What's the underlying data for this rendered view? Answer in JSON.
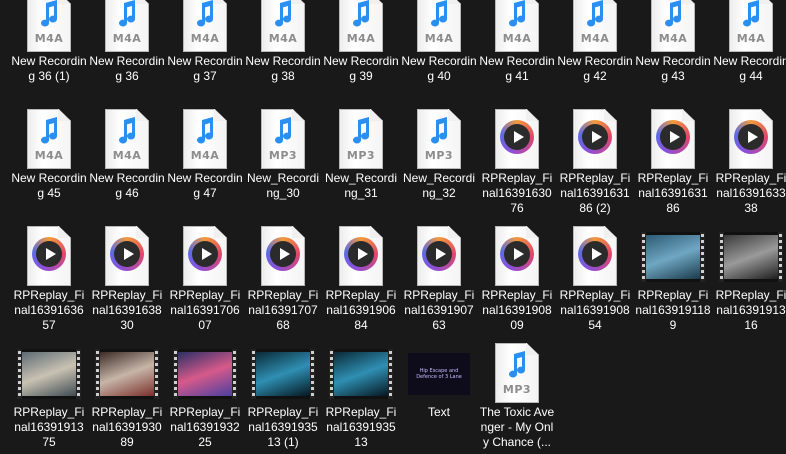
{
  "items": [
    {
      "label": "New Recording 36 (1)",
      "icon": "m4a-audio-file-icon",
      "ext": "M4A",
      "kind": "audio"
    },
    {
      "label": "New Recording 36",
      "icon": "m4a-audio-file-icon",
      "ext": "M4A",
      "kind": "audio"
    },
    {
      "label": "New Recording 37",
      "icon": "m4a-audio-file-icon",
      "ext": "M4A",
      "kind": "audio"
    },
    {
      "label": "New Recording 38",
      "icon": "m4a-audio-file-icon",
      "ext": "M4A",
      "kind": "audio"
    },
    {
      "label": "New Recording 39",
      "icon": "m4a-audio-file-icon",
      "ext": "M4A",
      "kind": "audio"
    },
    {
      "label": "New Recording 40",
      "icon": "m4a-audio-file-icon",
      "ext": "M4A",
      "kind": "audio"
    },
    {
      "label": "New Recording 41",
      "icon": "m4a-audio-file-icon",
      "ext": "M4A",
      "kind": "audio"
    },
    {
      "label": "New Recording 42",
      "icon": "m4a-audio-file-icon",
      "ext": "M4A",
      "kind": "audio"
    },
    {
      "label": "New Recording 43",
      "icon": "m4a-audio-file-icon",
      "ext": "M4A",
      "kind": "audio"
    },
    {
      "label": "New Recording 44",
      "icon": "m4a-audio-file-icon",
      "ext": "M4A",
      "kind": "audio"
    },
    {
      "label": "New Recording 45",
      "icon": "m4a-audio-file-icon",
      "ext": "M4A",
      "kind": "audio"
    },
    {
      "label": "New Recording 46",
      "icon": "m4a-audio-file-icon",
      "ext": "M4A",
      "kind": "audio"
    },
    {
      "label": "New Recording 47",
      "icon": "m4a-audio-file-icon",
      "ext": "M4A",
      "kind": "audio"
    },
    {
      "label": "New_Recording_30",
      "icon": "mp3-audio-file-icon",
      "ext": "MP3",
      "kind": "audio"
    },
    {
      "label": "New_Recording_31",
      "icon": "mp3-audio-file-icon",
      "ext": "MP3",
      "kind": "audio"
    },
    {
      "label": "New_Recording_32",
      "icon": "mp3-audio-file-icon",
      "ext": "MP3",
      "kind": "audio"
    },
    {
      "label": "RPReplay_Final1639163076",
      "icon": "video-file-play-icon",
      "kind": "video"
    },
    {
      "label": "RPReplay_Final1639163186 (2)",
      "icon": "video-file-play-icon",
      "kind": "video"
    },
    {
      "label": "RPReplay_Final1639163186",
      "icon": "video-file-play-icon",
      "kind": "video"
    },
    {
      "label": "RPReplay_Final1639163338",
      "icon": "video-file-play-icon",
      "kind": "video"
    },
    {
      "label": "RPReplay_Final1639163657",
      "icon": "video-file-play-icon",
      "kind": "video"
    },
    {
      "label": "RPReplay_Final1639163830",
      "icon": "video-file-play-icon",
      "kind": "video"
    },
    {
      "label": "RPReplay_Final1639170607",
      "icon": "video-file-play-icon",
      "kind": "video"
    },
    {
      "label": "RPReplay_Final1639170768",
      "icon": "video-file-play-icon",
      "kind": "video"
    },
    {
      "label": "RPReplay_Final1639190684",
      "icon": "video-file-play-icon",
      "kind": "video"
    },
    {
      "label": "RPReplay_Final1639190763",
      "icon": "video-file-play-icon",
      "kind": "video"
    },
    {
      "label": "RPReplay_Final1639190809",
      "icon": "video-file-play-icon",
      "kind": "video"
    },
    {
      "label": "RPReplay_Final1639190854",
      "icon": "video-file-play-icon",
      "kind": "video"
    },
    {
      "label": "RPReplay_Final1639191189",
      "icon": "video-thumbnail",
      "kind": "thumb",
      "colors": [
        "#2d5a73",
        "#6fa7c2",
        "#1b3a4a"
      ]
    },
    {
      "label": "RPReplay_Final1639191316",
      "icon": "video-thumbnail",
      "kind": "thumb",
      "colors": [
        "#3a3a3a",
        "#9a9a9a",
        "#1e1e1e"
      ]
    },
    {
      "label": "RPReplay_Final1639191375",
      "icon": "video-thumbnail",
      "kind": "thumb",
      "colors": [
        "#5d6a73",
        "#c9c2b3",
        "#3f4a52"
      ]
    },
    {
      "label": "RPReplay_Final1639193089",
      "icon": "video-thumbnail",
      "kind": "thumb",
      "colors": [
        "#3b2b26",
        "#c7b5a8",
        "#7a2f2a"
      ]
    },
    {
      "label": "RPReplay_Final1639193225",
      "icon": "video-thumbnail",
      "kind": "thumb",
      "colors": [
        "#2a2f66",
        "#d65a8a",
        "#4a3fa0"
      ]
    },
    {
      "label": "RPReplay_Final1639193513 (1)",
      "icon": "video-thumbnail",
      "kind": "thumb",
      "colors": [
        "#0a2a38",
        "#2f8fb3",
        "#06171f"
      ]
    },
    {
      "label": "RPReplay_Final1639193513",
      "icon": "video-thumbnail",
      "kind": "thumb",
      "colors": [
        "#0a2a38",
        "#2f8fb3",
        "#06171f"
      ]
    },
    {
      "label": "Text",
      "icon": "text-image-thumbnail",
      "kind": "text",
      "thumb_lines": [
        "Hip Escape and",
        "Defence of 3 Lane"
      ]
    },
    {
      "label": "The Toxic Avenger - My Only Chance (...",
      "icon": "mp3-audio-file-icon",
      "ext": "MP3",
      "kind": "audio"
    }
  ],
  "colors": {
    "background": "#191919",
    "note_blue": "#2a8ff0",
    "label": "#ffffff"
  }
}
